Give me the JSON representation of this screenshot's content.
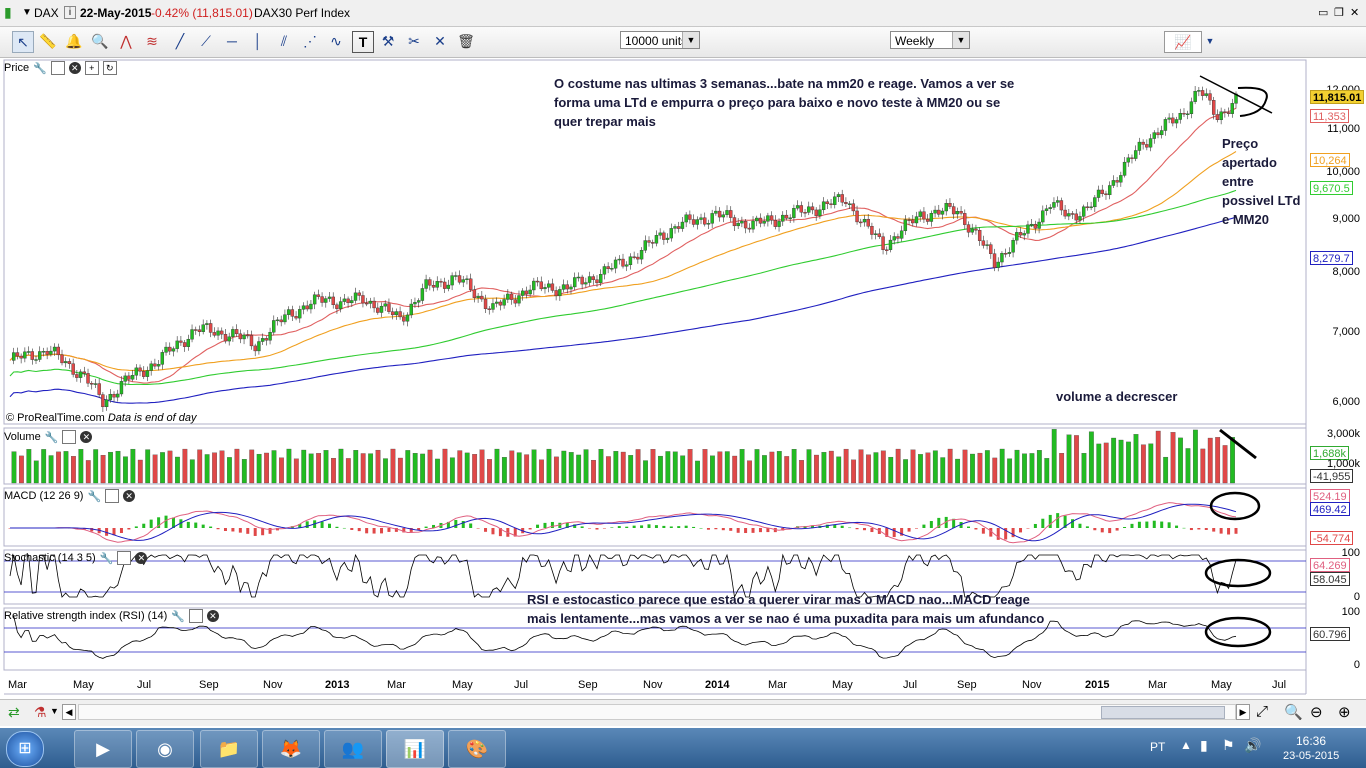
{
  "window": {
    "symbol": "DAX",
    "date": "22-May-2015",
    "change": "-0.42% (11,815.01)",
    "instrument": "DAX30 Perf Index"
  },
  "toolbar": {
    "units_value": "10000 units",
    "period_value": "Weekly"
  },
  "panels": {
    "price": {
      "label": "Price"
    },
    "volume": {
      "label": "Volume"
    },
    "macd": {
      "label": "MACD (12 26 9)"
    },
    "stochastic": {
      "label": "Stochastic (14 3 5)"
    },
    "rsi": {
      "label": "Relative strength index (RSI) (14)"
    }
  },
  "price_axis": [
    "12,000",
    "11,000",
    "10,000",
    "9,000",
    "8,000",
    "7,000",
    "6,000"
  ],
  "price_values": {
    "last": "11,815.01",
    "mm20": "11,353",
    "mm50": "10,264",
    "mm100": "9,670.5",
    "mm200": "8,279.7"
  },
  "volume_axis": [
    "3,000k",
    "1,000k"
  ],
  "volume_values": {
    "v1": "1,688k",
    "v2": "-41,955"
  },
  "macd_values": {
    "m1": "524.19",
    "m2": "469.42",
    "m3": "-54.774"
  },
  "stoch_axis": {
    "top": "100",
    "bottom": "0"
  },
  "stoch_values": {
    "s1": "64.269",
    "s2": "58.045"
  },
  "rsi_axis": {
    "top": "100",
    "bottom": "0"
  },
  "rsi_value": "60.796",
  "x_axis": [
    "Mar",
    "May",
    "Jul",
    "Sep",
    "Nov",
    "2013",
    "Mar",
    "May",
    "Jul",
    "Sep",
    "Nov",
    "2014",
    "Mar",
    "May",
    "Jul",
    "Sep",
    "Nov",
    "2015",
    "Mar",
    "May",
    "Jul"
  ],
  "footer": {
    "copyright": "© ProRealTime.com",
    "note": "Data is end of day"
  },
  "annotations": {
    "a1": "O costume nas ultimas 3 semanas...bate na mm20 e reage. Vamos a ver se forma uma LTd e empurra o preço para baixo e novo teste à MM20 ou se quer trepar mais",
    "a2": "Preço apertado entre possivel LTd e MM20",
    "a3": "volume a decrescer",
    "a4": "RSI e estocastico parece que estao a querer virar mas o MACD nao...MACD reage mais lentamente...mas vamos a ver se nao é uma puxadita para mais um afundanco"
  },
  "colors": {
    "up": "#22bb22",
    "down": "#e04848",
    "mm20": "#e06060",
    "mm50": "#f0a020",
    "mm100": "#30cc30",
    "mm200": "#2020c0"
  },
  "taskbar": {
    "lang": "PT",
    "time": "16:36",
    "date": "23-05-2015"
  }
}
